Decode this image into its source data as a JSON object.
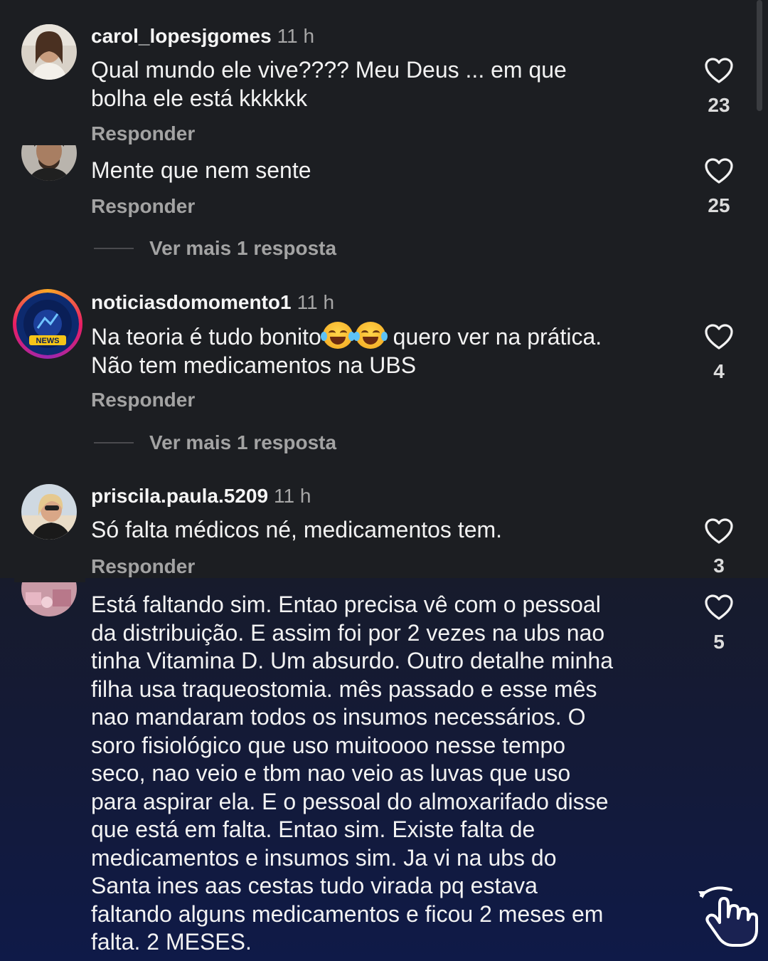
{
  "comments": [
    {
      "username": "carol_lopesjgomes",
      "time": "11 h",
      "text_lines": [
        "Qual mundo ele vive???? Meu Deus ... em que",
        "bolha ele está kkkkkk"
      ],
      "reply_label": "Responder",
      "likes": "23",
      "avatar_icon": "profile-photo"
    },
    {
      "username": "",
      "time": "",
      "text_lines": [
        "Mente que nem sente"
      ],
      "reply_label": "Responder",
      "likes": "25",
      "more_replies": "Ver mais 1 resposta",
      "avatar_icon": "profile-photo"
    },
    {
      "username": "noticiasdomomento1",
      "time": "11 h",
      "text_before_emoji": "Na teoria é tudo bonito",
      "text_after_emoji": " quero ver na prática.",
      "emoji": "😂😂",
      "text_line2": "Não tem medicamentos na UBS",
      "reply_label": "Responder",
      "likes": "4",
      "more_replies": "Ver mais 1 resposta",
      "avatar_text": "NEWS",
      "avatar_icon": "news-logo"
    },
    {
      "username": "priscila.paula.5209",
      "time": "11 h",
      "text_lines": [
        "Só falta médicos né, medicamentos tem."
      ],
      "reply_label": "Responder",
      "likes": "3",
      "avatar_icon": "profile-photo"
    },
    {
      "username": "",
      "time": "",
      "text_lines": [
        "Está faltando sim. Entao precisa vê com o pessoal",
        "da distribuição. E assim foi por 2 vezes na ubs nao",
        "tinha Vitamina D. Um absurdo. Outro detalhe minha",
        "filha usa traqueostomia. mês passado e esse mês",
        "nao mandaram todos os insumos necessários. O",
        "soro fisiológico que uso muitoooo nesse tempo",
        "seco, nao veio e tbm nao veio as luvas que uso",
        "para aspirar ela. E o pessoal do almoxarifado disse",
        "que está em falta. Entao sim. Existe falta de",
        "medicamentos e insumos sim. Ja vi na ubs do",
        "Santa ines aas cestas tudo virada pq estava",
        "faltando alguns medicamentos e ficou 2 meses em",
        "falta. 2 MESES."
      ],
      "likes": "5",
      "avatar_icon": "profile-photo"
    }
  ],
  "icons": {
    "like": "heart-outline-icon",
    "gesture": "tap-hand-icon"
  },
  "colors": {
    "background": "#1c1e22",
    "text": "#f2f2f2",
    "muted": "#a3a3a3",
    "overlay": "#131a3a"
  }
}
